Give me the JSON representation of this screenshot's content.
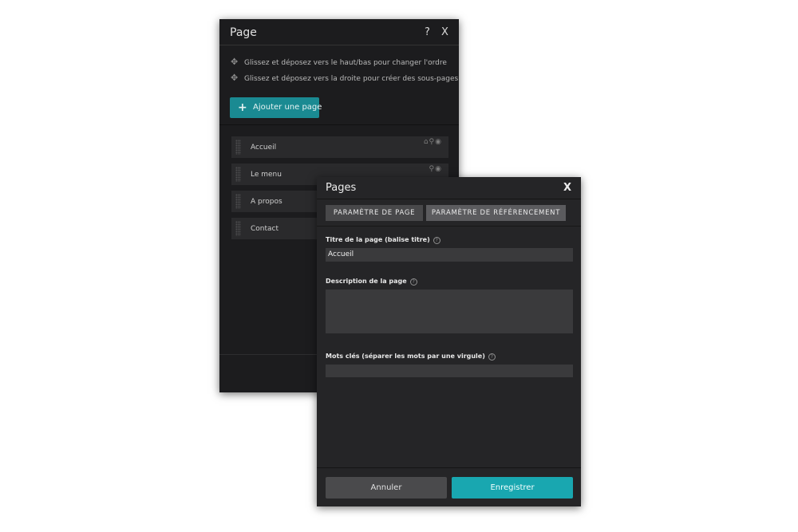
{
  "page_panel": {
    "title": "Page",
    "help": "?",
    "close": "X",
    "hints": [
      {
        "icon": "move-vertical-icon",
        "text": "Glissez et déposez vers le haut/bas pour changer l'ordre"
      },
      {
        "icon": "move-horizontal-icon",
        "text": "Glissez et déposez vers la droite pour créer des sous-pages"
      }
    ],
    "add_button": "Ajouter une page",
    "pages": [
      {
        "label": "Accueil",
        "icons": "⌂⚲◉"
      },
      {
        "label": "Le menu",
        "icons": "⚲◉"
      },
      {
        "label": "A propos",
        "icons": ""
      },
      {
        "label": "Contact",
        "icons": ""
      }
    ]
  },
  "pages_dialog": {
    "title": "Pages",
    "close": "X",
    "tabs": [
      "PARAMÈTRE DE PAGE",
      "PARAMÈTRE DE RÉFÉRENCEMENT"
    ],
    "active_tab": 1,
    "fields": {
      "title_label": "Titre de la page (balise titre)",
      "title_value": "Accueil",
      "description_label": "Description de la page",
      "description_value": "",
      "keywords_label": "Mots clés (séparer les mots par une virgule)",
      "keywords_value": ""
    },
    "help_glyph": "?",
    "cancel": "Annuler",
    "save": "Enregistrer"
  },
  "colors": {
    "accent": "#19a7b0",
    "add_button": "#1a8a92",
    "panel": "#1c1c1e",
    "dialog": "#252527"
  }
}
